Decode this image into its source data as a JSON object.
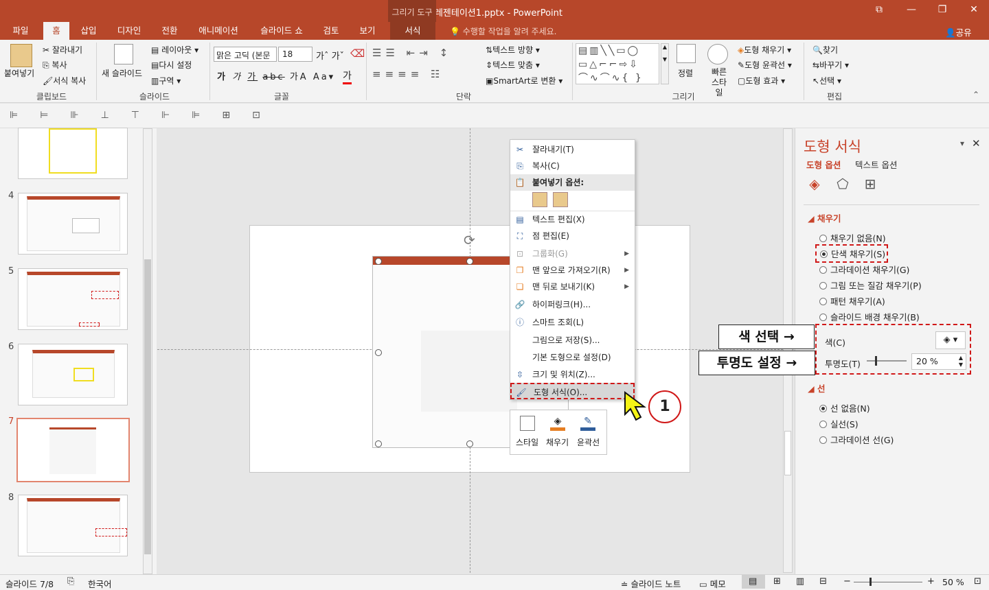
{
  "window": {
    "title": "프레젠테이션1.pptx - PowerPoint",
    "tool_tab": "그리기 도구",
    "controls": [
      "⧉",
      "—",
      "❐",
      "✕"
    ]
  },
  "tabs": [
    "파일",
    "홈",
    "삽입",
    "디자인",
    "전환",
    "애니메이션",
    "슬라이드 쇼",
    "검토",
    "보기",
    "서식"
  ],
  "tell_me": "수행할 작업을 알려 주세요.",
  "share": "공유",
  "ribbon": {
    "clipboard": {
      "paste": "붙여넣기",
      "cut": "잘라내기",
      "copy": "복사",
      "format_painter": "서식 복사",
      "group": "클립보드"
    },
    "slides": {
      "new_slide": "새 슬라이드",
      "layout": "레이아웃",
      "reset": "다시 설정",
      "section": "구역",
      "group": "슬라이드"
    },
    "font": {
      "name": "맑은 고딕 (본문",
      "size": "18",
      "group": "글꼴"
    },
    "paragraph": {
      "text_direction": "텍스트 방향",
      "align_text": "텍스트 맞춤",
      "smartart": "SmartArt로 변환",
      "group": "단락"
    },
    "drawing": {
      "arrange": "정렬",
      "quick_styles": "빠른 스타일",
      "shape_fill": "도형 채우기",
      "shape_outline": "도형 윤곽선",
      "shape_effects": "도형 효과",
      "group": "그리기"
    },
    "editing": {
      "find": "찾기",
      "replace": "바꾸기",
      "select": "선택",
      "group": "편집"
    }
  },
  "thumbnails": [
    {
      "num": "",
      "selected": false
    },
    {
      "num": "4",
      "selected": false
    },
    {
      "num": "5",
      "selected": false
    },
    {
      "num": "6",
      "selected": false
    },
    {
      "num": "7",
      "selected": true
    },
    {
      "num": "8",
      "selected": false
    }
  ],
  "context_menu": {
    "cut": "잘라내기(T)",
    "copy": "복사(C)",
    "paste_options": "붙여넣기 옵션:",
    "edit_text": "텍스트 편집(X)",
    "edit_points": "점 편집(E)",
    "group": "그룹화(G)",
    "bring_front": "맨 앞으로 가져오기(R)",
    "send_back": "맨 뒤로 보내기(K)",
    "hyperlink": "하이퍼링크(H)...",
    "smart_lookup": "스마트 조회(L)",
    "save_picture": "그림으로 저장(S)...",
    "set_default": "기본 도형으로 설정(D)",
    "size_position": "크기 및 위치(Z)...",
    "format_shape": "도형 서식(O)..."
  },
  "mini_toolbar": {
    "style": "스타일",
    "fill": "채우기",
    "outline": "윤곽선"
  },
  "step_marker": "1",
  "format_pane": {
    "title": "도형 서식",
    "tab_shape": "도형 옵션",
    "tab_text": "텍스트 옵션",
    "fill_header": "채우기",
    "fill_options": [
      "채우기 없음(N)",
      "단색 채우기(S)",
      "그라데이션 채우기(G)",
      "그림 또는 질감 채우기(P)",
      "패턴 채우기(A)",
      "슬라이드 배경 채우기(B)"
    ],
    "fill_selected": 1,
    "color_label": "색(C)",
    "transparency_label": "투명도(T)",
    "transparency_value": "20 %",
    "transparency": 0.2,
    "line_header": "선",
    "line_options": [
      "선 없음(N)",
      "실선(S)",
      "그라데이션 선(G)"
    ],
    "line_selected": 0
  },
  "callouts": {
    "color": "색 선택 →",
    "transparency": "투명도 설정 →"
  },
  "status": {
    "slide": "슬라이드 7/8",
    "language": "한국어",
    "notes": "슬라이드 노트",
    "comments": "메모",
    "zoom": "50 %"
  },
  "colors": {
    "accent": "#b7472a",
    "callout_border": "#d01818"
  }
}
